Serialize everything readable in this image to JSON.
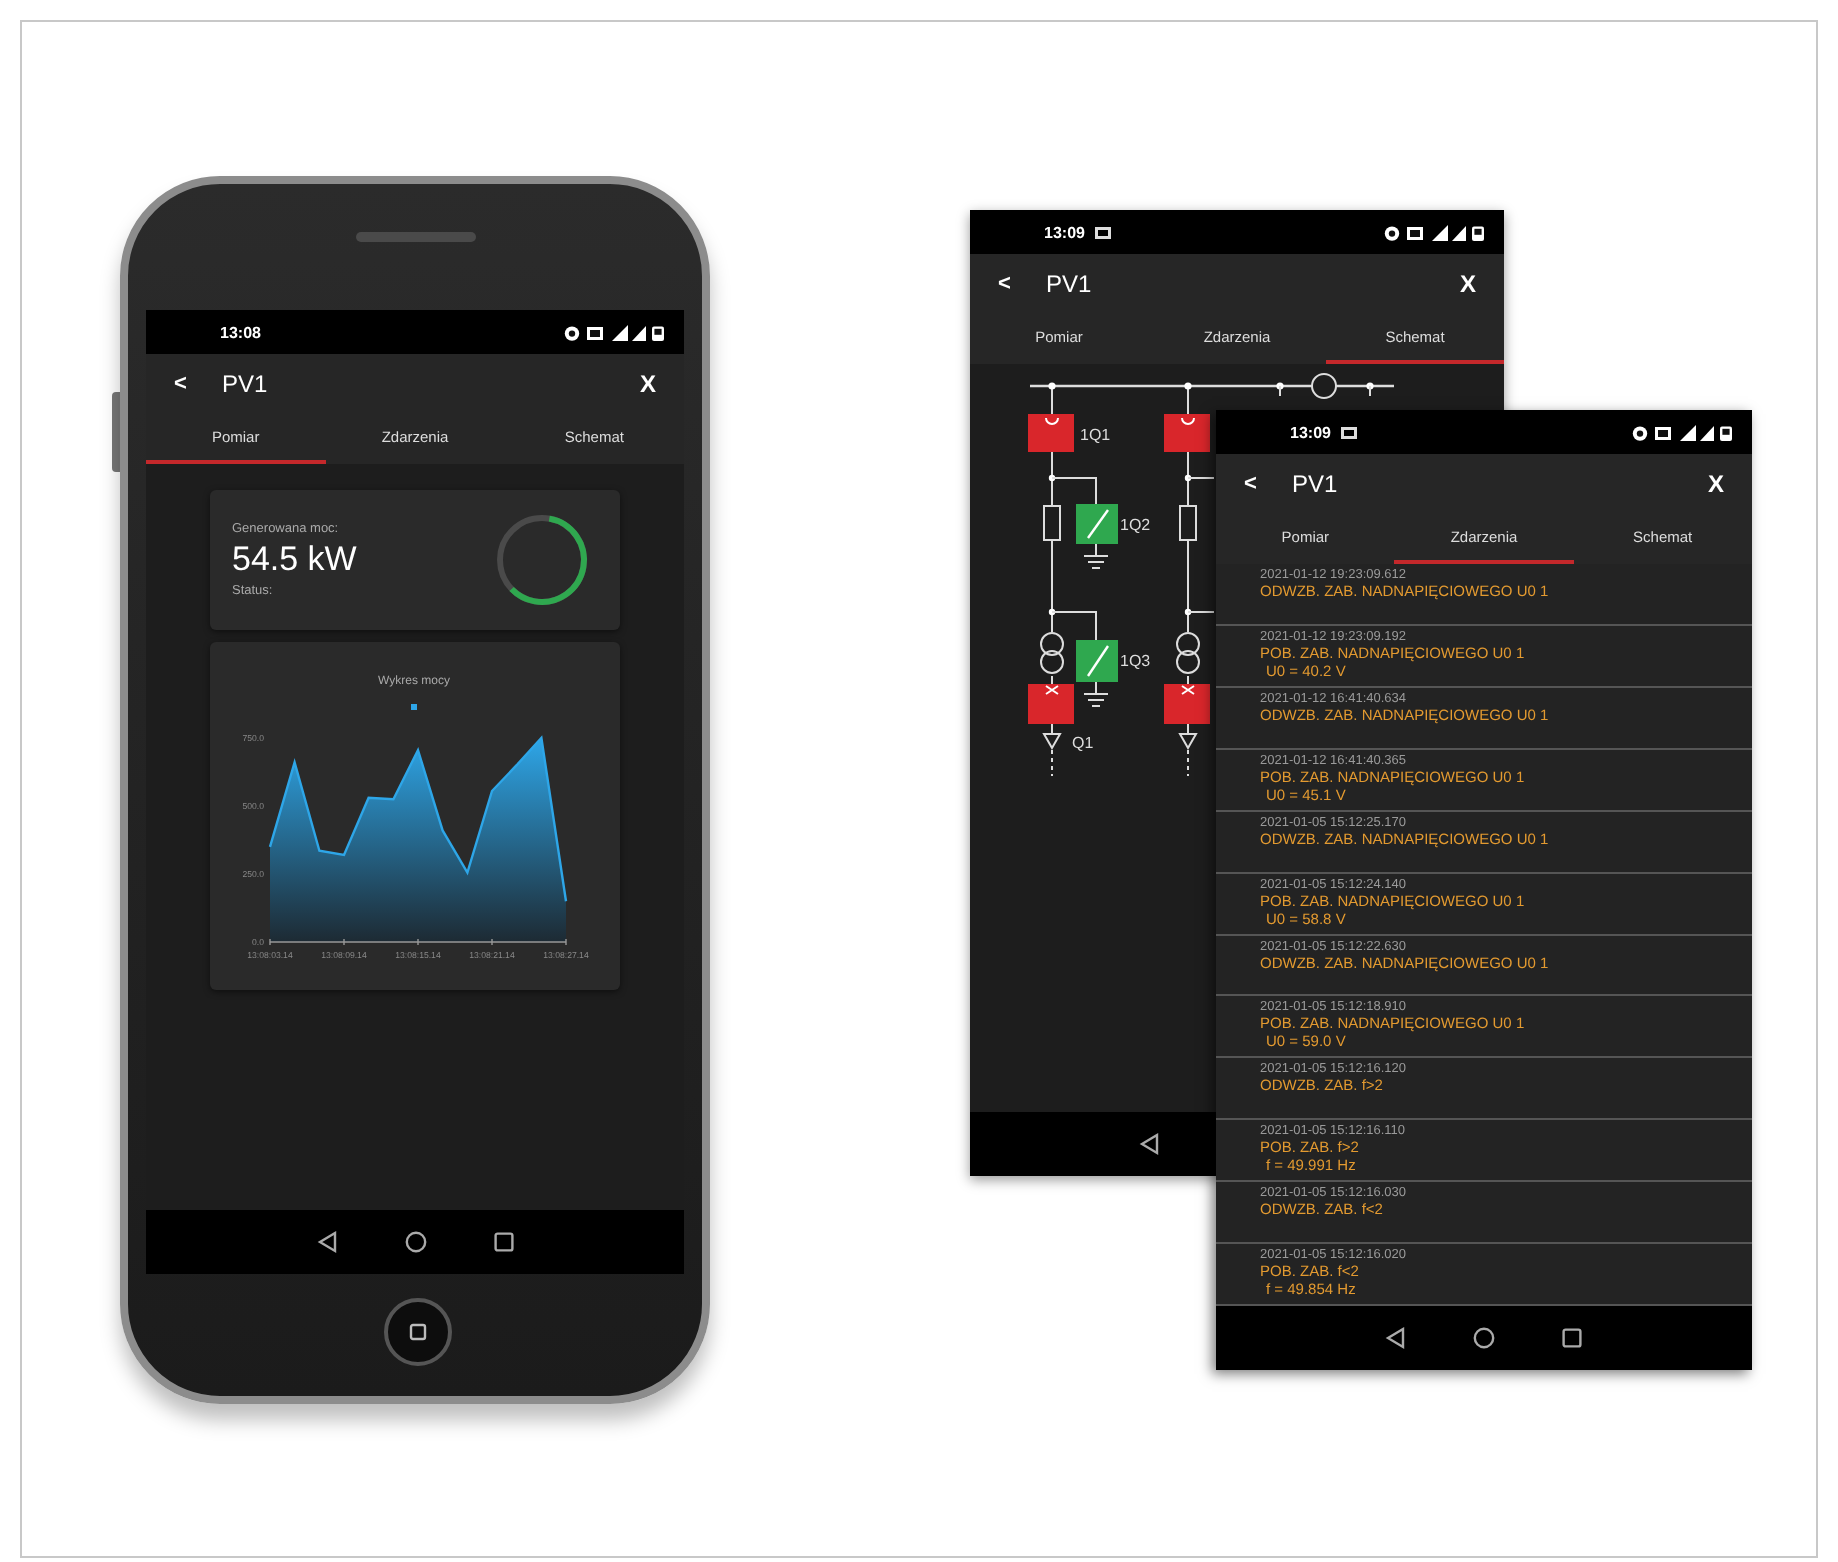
{
  "left_phone": {
    "status_bar": {
      "time": "13:08"
    },
    "app_bar": {
      "back": "<",
      "title": "PV1",
      "close": "X"
    },
    "tabs": [
      {
        "label": "Pomiar",
        "selected": true
      },
      {
        "label": "Zdarzenia",
        "selected": false
      },
      {
        "label": "Schemat",
        "selected": false
      }
    ],
    "power_card": {
      "label": "Generowana moc:",
      "value": "54.5 kW",
      "status_label": "Status:",
      "level": 0.6
    },
    "chart_card": {
      "chart_data": {
        "type": "area",
        "title": "Wykres mocy",
        "categories": [
          "13:08:03.14",
          null,
          null,
          "13:08:09.14",
          null,
          null,
          "13:08:15.14",
          null,
          null,
          "13:08:21.14",
          null,
          null,
          "13:08:27.14"
        ],
        "series": [
          {
            "color": "#2ea6e8",
            "values": [
              350,
              660,
              335,
              320,
              530,
              525,
              705,
              410,
              255,
              555,
              650,
              750,
              150
            ]
          }
        ],
        "yticks": [
          {
            "value": 0,
            "label": "0.0"
          },
          {
            "value": 250,
            "label": "250.0"
          },
          {
            "value": 500,
            "label": "500.0"
          },
          {
            "value": 750,
            "label": "750.0"
          }
        ],
        "ylim": [
          0,
          750
        ]
      }
    }
  },
  "schematic_screen": {
    "status_bar": {
      "time": "13:09"
    },
    "app_bar": {
      "back": "<",
      "title": "PV1",
      "close": "X"
    },
    "tabs": [
      {
        "label": "Pomiar",
        "selected": false
      },
      {
        "label": "Zdarzenia",
        "selected": false
      },
      {
        "label": "Schemat",
        "selected": true
      }
    ],
    "diagram_labels": [
      "1Q1",
      "1Q2",
      "1Q3",
      "Q1"
    ]
  },
  "events_screen": {
    "status_bar": {
      "time": "13:09"
    },
    "app_bar": {
      "back": "<",
      "title": "PV1",
      "close": "X"
    },
    "tabs": [
      {
        "label": "Pomiar",
        "selected": false
      },
      {
        "label": "Zdarzenia",
        "selected": true
      },
      {
        "label": "Schemat",
        "selected": false
      }
    ],
    "events": [
      {
        "time": "2021-01-12 19:23:09.612",
        "title": "ODWZB. ZAB. NADNAPIĘCIOWEGO U0 1"
      },
      {
        "time": "2021-01-12 19:23:09.192",
        "title": "POB. ZAB. NADNAPIĘCIOWEGO U0 1",
        "detail": "U0 = 40.2 V"
      },
      {
        "time": "2021-01-12 16:41:40.634",
        "title": "ODWZB. ZAB. NADNAPIĘCIOWEGO U0 1"
      },
      {
        "time": "2021-01-12 16:41:40.365",
        "title": "POB. ZAB. NADNAPIĘCIOWEGO U0 1",
        "detail": "U0 = 45.1 V"
      },
      {
        "time": "2021-01-05 15:12:25.170",
        "title": "ODWZB. ZAB. NADNAPIĘCIOWEGO U0 1"
      },
      {
        "time": "2021-01-05 15:12:24.140",
        "title": "POB. ZAB. NADNAPIĘCIOWEGO U0 1",
        "detail": "U0 = 58.8 V"
      },
      {
        "time": "2021-01-05 15:12:22.630",
        "title": "ODWZB. ZAB. NADNAPIĘCIOWEGO U0 1"
      },
      {
        "time": "2021-01-05 15:12:18.910",
        "title": "POB. ZAB. NADNAPIĘCIOWEGO U0 1",
        "detail": "U0 = 59.0 V"
      },
      {
        "time": "2021-01-05 15:12:16.120",
        "title": "ODWZB. ZAB. f>2"
      },
      {
        "time": "2021-01-05 15:12:16.110",
        "title": "POB. ZAB. f>2",
        "detail": "f = 49.991 Hz"
      },
      {
        "time": "2021-01-05 15:12:16.030",
        "title": "ODWZB. ZAB. f<2"
      },
      {
        "time": "2021-01-05 15:12:16.020",
        "title": "POB. ZAB. f<2",
        "detail": "f = 49.854 Hz"
      }
    ]
  }
}
